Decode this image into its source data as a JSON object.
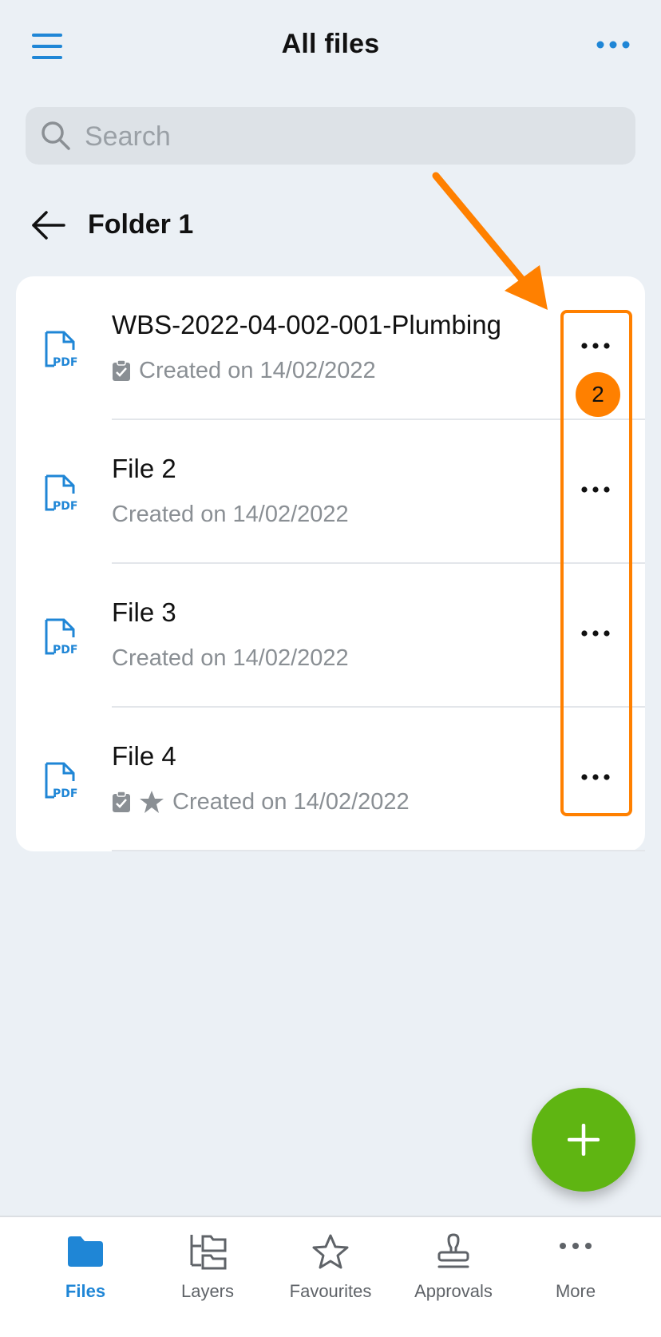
{
  "header": {
    "title": "All files",
    "menu_icon": "hamburger-menu-icon",
    "overflow_icon": "more-horizontal-icon"
  },
  "search": {
    "placeholder": "Search",
    "icon": "search-icon"
  },
  "breadcrumb": {
    "back_icon": "arrow-left-icon",
    "folder_name": "Folder 1"
  },
  "files": [
    {
      "name": "WBS-2022-04-002-001-Plumbing",
      "created": "Created on 14/02/2022",
      "approved": true,
      "favourite": false
    },
    {
      "name": "File 2",
      "created": "Created on 14/02/2022",
      "approved": false,
      "favourite": false
    },
    {
      "name": "File 3",
      "created": "Created on 14/02/2022",
      "approved": false,
      "favourite": false
    },
    {
      "name": "File 4",
      "created": "Created on 14/02/2022",
      "approved": true,
      "favourite": true
    }
  ],
  "annotation": {
    "step_number": "2",
    "color": "#ff8000"
  },
  "fab": {
    "icon": "plus-icon",
    "color": "#5fb512"
  },
  "bottom_nav": [
    {
      "label": "Files",
      "icon": "folder-icon",
      "active": true
    },
    {
      "label": "Layers",
      "icon": "layers-icon",
      "active": false
    },
    {
      "label": "Favourites",
      "icon": "star-icon",
      "active": false
    },
    {
      "label": "Approvals",
      "icon": "stamp-icon",
      "active": false
    },
    {
      "label": "More",
      "icon": "more-horizontal-icon",
      "active": false
    }
  ],
  "colors": {
    "accent": "#1f86d6",
    "background": "#ebf0f5",
    "muted_text": "#8a8f94"
  }
}
